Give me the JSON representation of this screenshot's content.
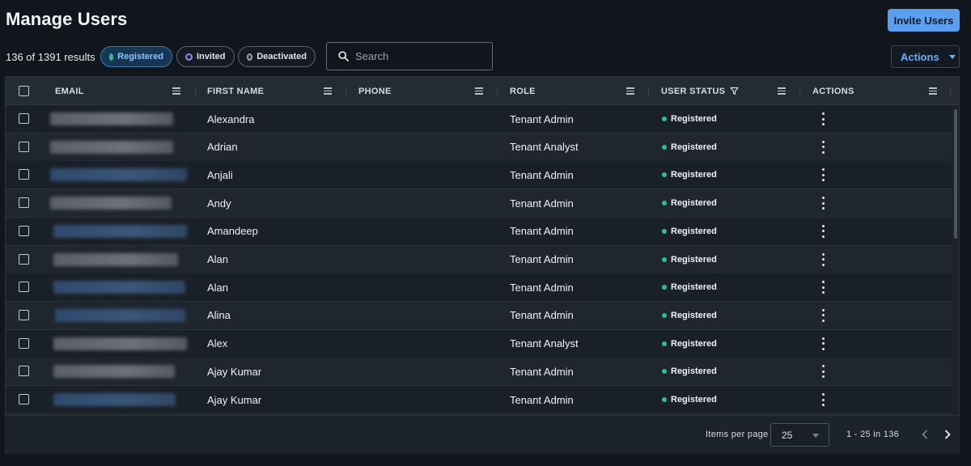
{
  "header": {
    "title": "Manage Users",
    "invite_label": "Invite Users"
  },
  "toolbar": {
    "results_text": "136 of 1391 results",
    "chips": {
      "registered": "Registered",
      "invited": "Invited",
      "deactivated": "Deactivated"
    },
    "search_placeholder": "Search",
    "actions_label": "Actions"
  },
  "colors": {
    "accent": "#5b9fef",
    "registered": "#2dbf8e",
    "invited": "#9a83f5"
  },
  "table": {
    "columns": {
      "email": "EMAIL",
      "first_name": "FIRST NAME",
      "phone": "PHONE",
      "role": "ROLE",
      "user_status": "USER STATUS",
      "actions": "ACTIONS"
    },
    "rows": [
      {
        "first_name": "Alexandra",
        "phone": "",
        "role": "Tenant Admin",
        "status": "Registered",
        "email_tone": "gray"
      },
      {
        "first_name": "Adrian",
        "phone": "",
        "role": "Tenant Analyst",
        "status": "Registered",
        "email_tone": "gray"
      },
      {
        "first_name": "Anjali",
        "phone": "",
        "role": "Tenant Admin",
        "status": "Registered",
        "email_tone": "blue"
      },
      {
        "first_name": "Andy",
        "phone": "",
        "role": "Tenant Admin",
        "status": "Registered",
        "email_tone": "gray"
      },
      {
        "first_name": "Amandeep",
        "phone": "",
        "role": "Tenant Admin",
        "status": "Registered",
        "email_tone": "blue"
      },
      {
        "first_name": "Alan",
        "phone": "",
        "role": "Tenant Admin",
        "status": "Registered",
        "email_tone": "gray"
      },
      {
        "first_name": "Alan",
        "phone": "",
        "role": "Tenant Admin",
        "status": "Registered",
        "email_tone": "blue"
      },
      {
        "first_name": "Alina",
        "phone": "",
        "role": "Tenant Admin",
        "status": "Registered",
        "email_tone": "blue"
      },
      {
        "first_name": "Alex",
        "phone": "",
        "role": "Tenant Analyst",
        "status": "Registered",
        "email_tone": "gray"
      },
      {
        "first_name": "Ajay Kumar",
        "phone": "",
        "role": "Tenant Admin",
        "status": "Registered",
        "email_tone": "gray"
      },
      {
        "first_name": "Ajay Kumar",
        "phone": "",
        "role": "Tenant Admin",
        "status": "Registered",
        "email_tone": "blue"
      }
    ]
  },
  "footer": {
    "items_per_page_label": "Items per page",
    "items_per_page_value": "25",
    "range_text": "1 - 25 in 136"
  }
}
